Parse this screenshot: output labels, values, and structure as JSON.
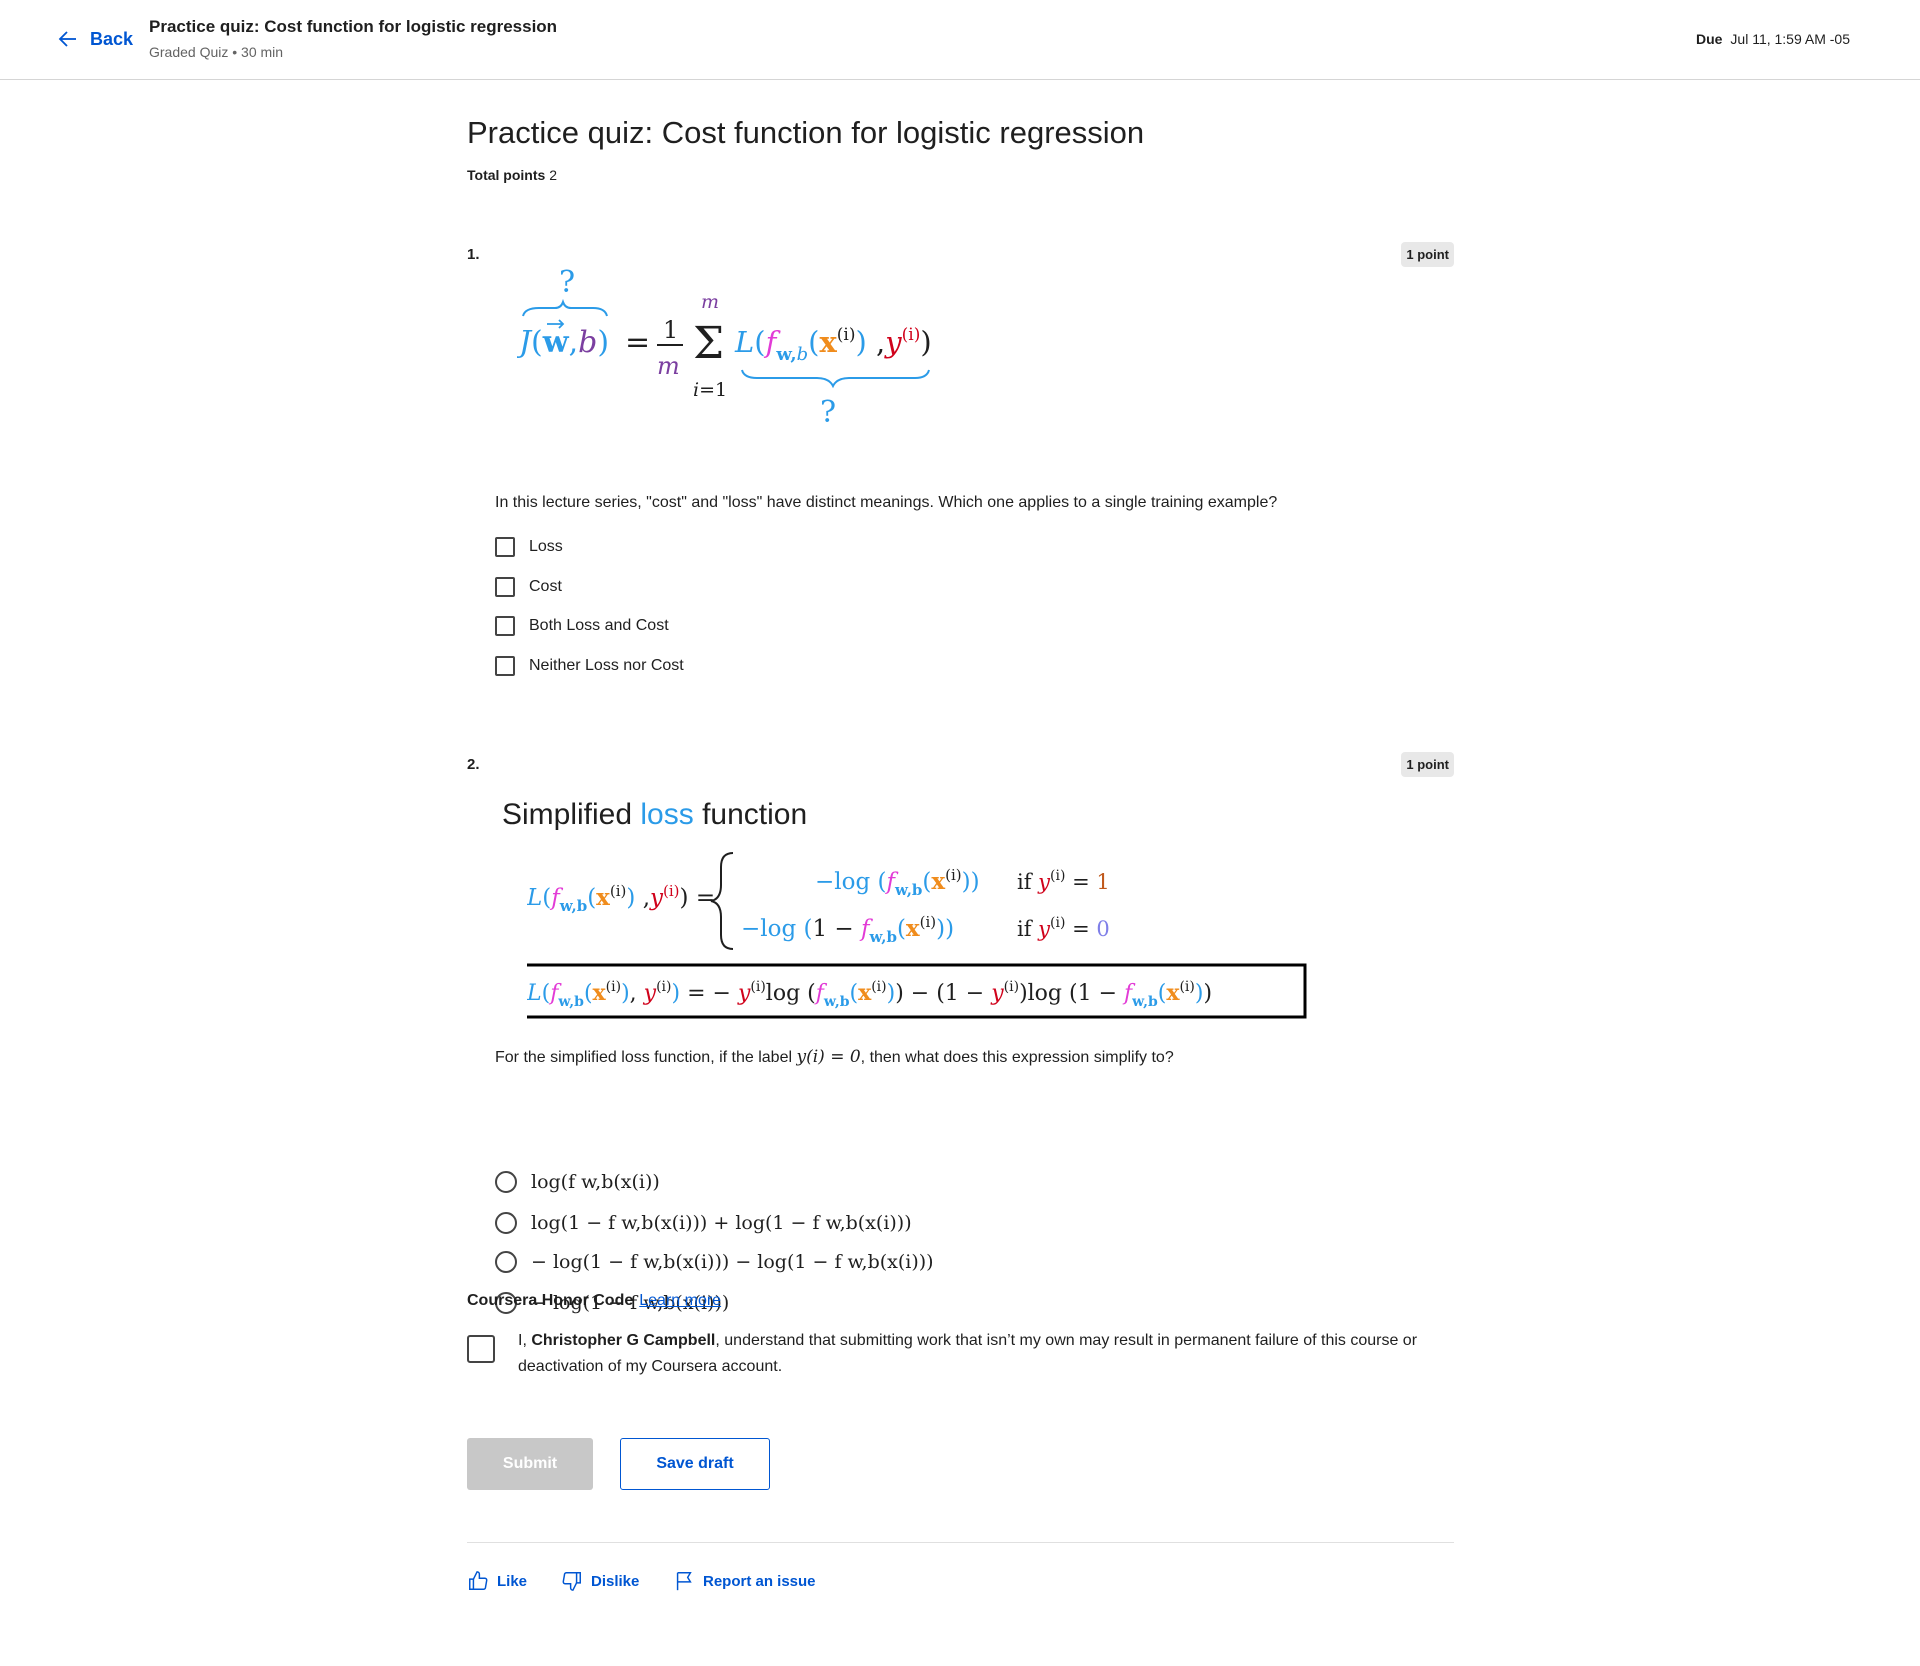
{
  "header": {
    "back_label": "Back",
    "title": "Practice quiz: Cost function for logistic regression",
    "subtitle": "Graded Quiz • 30 min",
    "due_label": "Due",
    "due_value": "Jul 11, 1:59 AM -05"
  },
  "quiz": {
    "title": "Practice quiz: Cost function for logistic regression",
    "total_points_label": "Total points",
    "total_points_value": "2"
  },
  "questions": [
    {
      "number": "1.",
      "points": "1 point",
      "formula": {
        "question_mark": "?",
        "lhs": "J(w,b)",
        "fraction": "1/m",
        "sum_upper": "m",
        "sum_lower": "i=1",
        "summand": "L(f w,b (x(i)), y(i))"
      },
      "text": "In this lecture series, \"cost\" and \"loss\" have distinct meanings. Which one applies to a single training example?",
      "options": [
        "Loss",
        "Cost",
        "Both Loss and Cost",
        "Neither Loss nor Cost"
      ]
    },
    {
      "number": "2.",
      "points": "1 point",
      "slide": {
        "title_prefix": "Simplified ",
        "title_highlight": "loss",
        "title_suffix": " function",
        "case_one_condition": "if y(i) = 1",
        "case_zero_condition": "if y(i) = 0"
      },
      "text_before": "For the simplified loss function, if the label ",
      "text_math": "y(i) = 0",
      "text_after": ", then what does this expression simplify to?",
      "options": [
        "log(f w,b(x(i))",
        "log(1 − f w,b(x(i))) + log(1 − f w,b(x(i)))",
        "− log(1 − f w,b(x(i))) − log(1 − f w,b(x(i)))",
        "− log(1 − f w,b(x(i)))"
      ]
    }
  ],
  "honor": {
    "title": "Coursera Honor Code",
    "learn_more": "Learn more",
    "text_prefix": "I, ",
    "name": "Christopher G Campbell",
    "text_suffix": ", understand that submitting work that isn’t my own may result in permanent failure of this course or deactivation of my Coursera account."
  },
  "actions": {
    "submit": "Submit",
    "save_draft": "Save draft"
  },
  "feedback": {
    "like": "Like",
    "dislike": "Dislike",
    "report": "Report an issue"
  },
  "colors": {
    "brand_blue": "#0056d2",
    "formula_blue": "#2b9be8",
    "formula_red": "#d0021b",
    "formula_orange": "#f08c1c",
    "formula_purple": "#7b3fa0",
    "formula_magenta": "#e23bd6"
  }
}
